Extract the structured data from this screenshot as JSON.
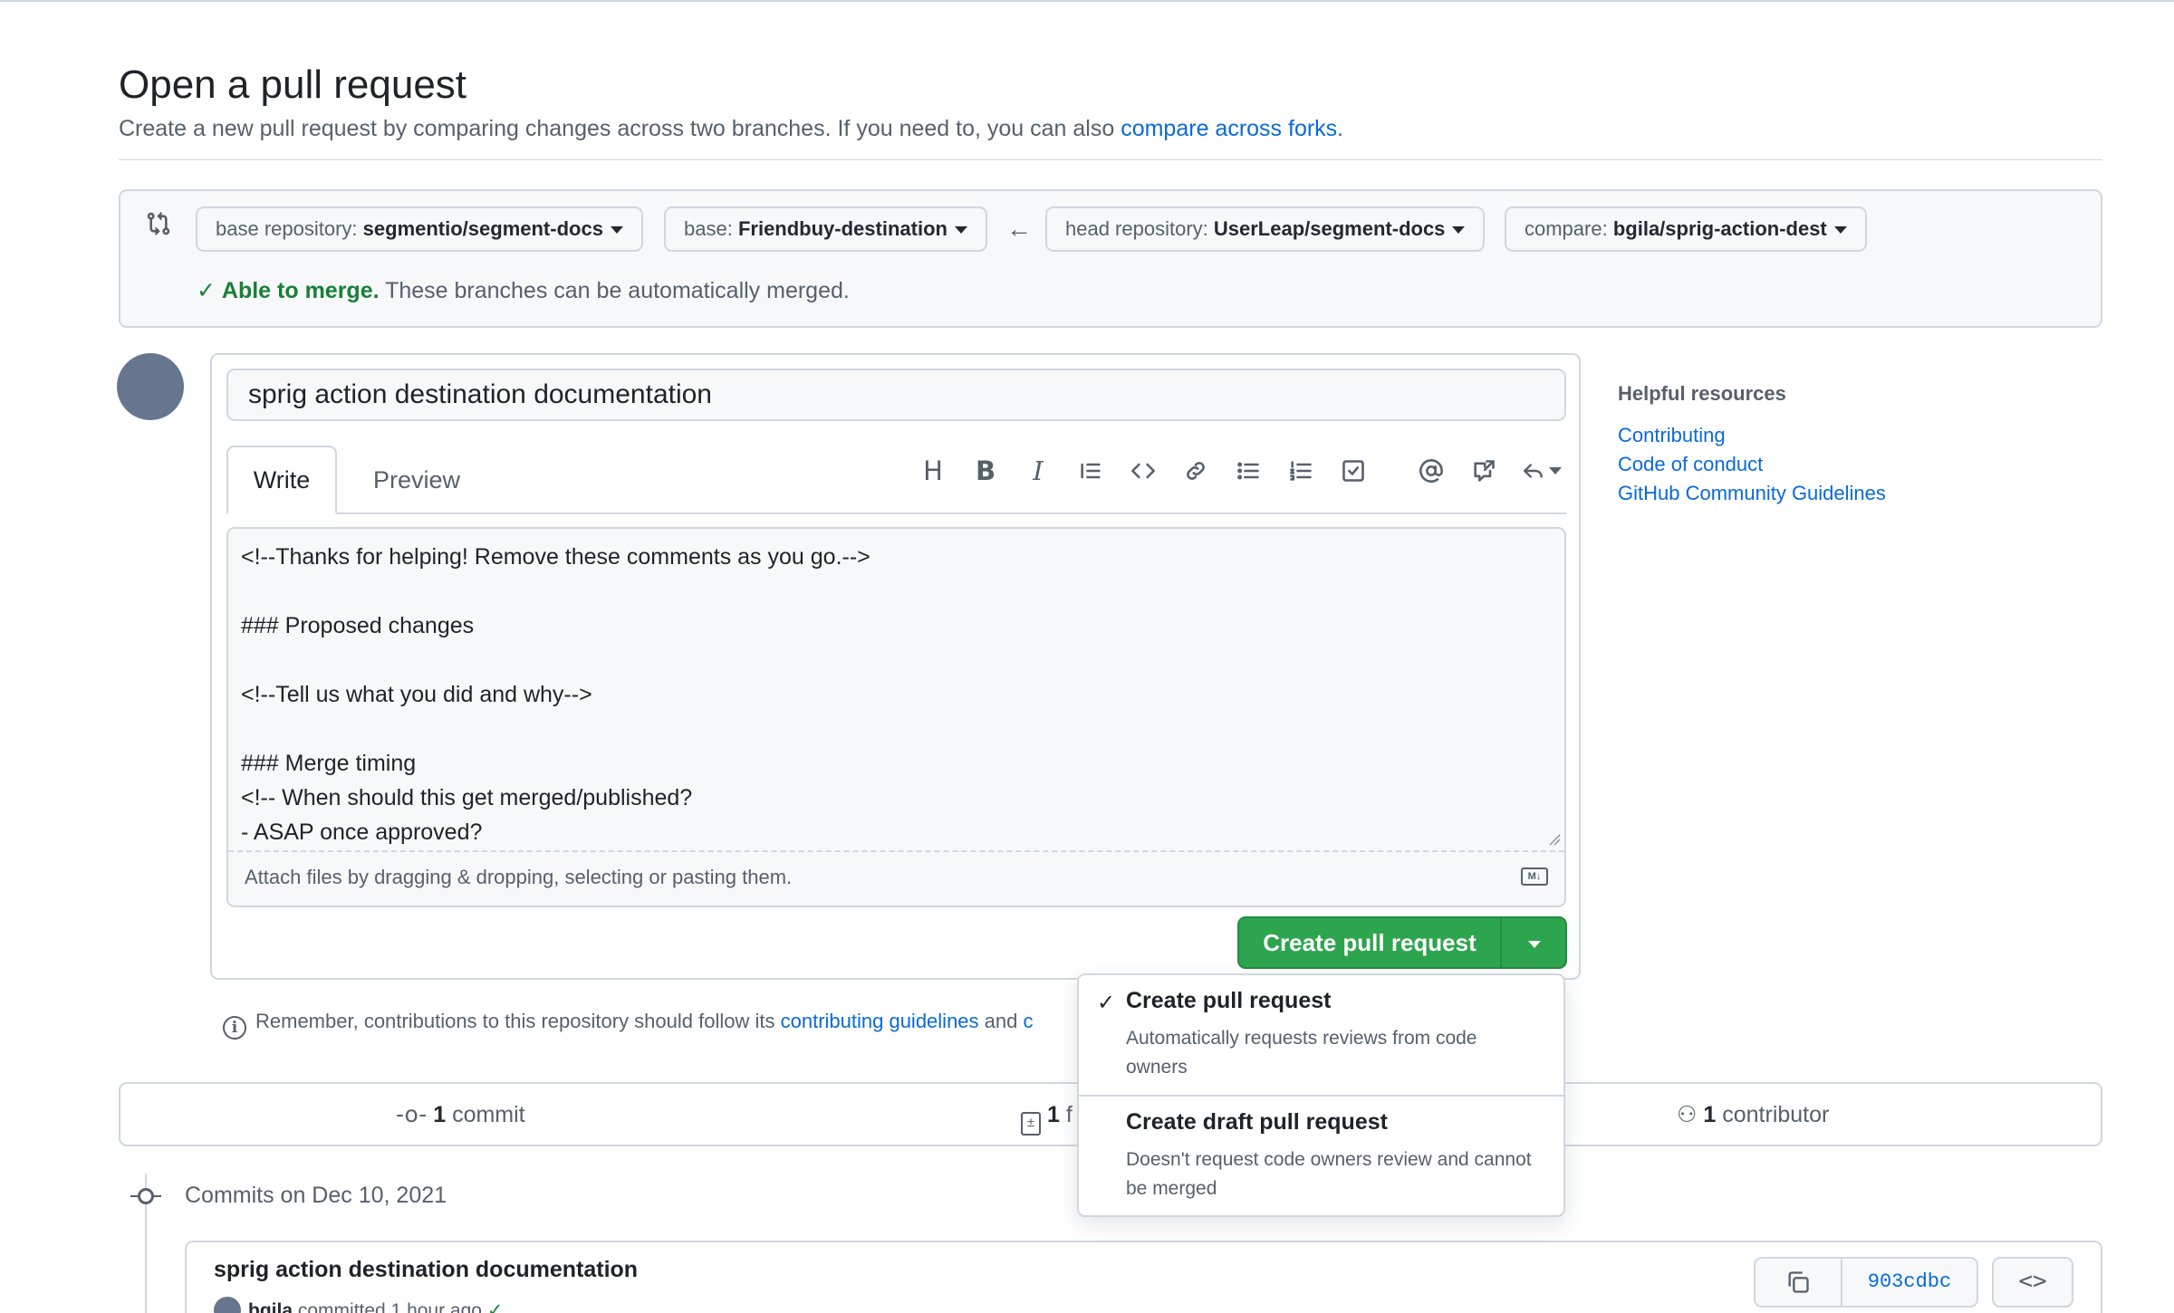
{
  "header": {
    "title": "Open a pull request",
    "subtitle_prefix": "Create a new pull request by comparing changes across two branches. If you need to, you can also ",
    "subtitle_link": "compare across forks",
    "subtitle_suffix": "."
  },
  "range": {
    "base_repo_label": "base repository:",
    "base_repo_value": "segmentio/segment-docs",
    "base_label": "base:",
    "base_value": "Friendbuy-destination",
    "head_repo_label": "head repository:",
    "head_repo_value": "UserLeap/segment-docs",
    "compare_label": "compare:",
    "compare_value": "bgila/sprig-action-dest",
    "merge_ok": "Able to merge.",
    "merge_text": "These branches can be automatically merged."
  },
  "form": {
    "title_value": "sprig action destination documentation",
    "tab_write": "Write",
    "tab_preview": "Preview",
    "toolbar": [
      "heading-icon",
      "bold-icon",
      "italic-icon",
      "quote-icon",
      "code-icon",
      "link-icon",
      "unordered-list-icon",
      "ordered-list-icon",
      "task-list-icon",
      "mention-icon",
      "cross-reference-icon",
      "reply-icon"
    ],
    "body_text": "<!--Thanks for helping! Remove these comments as you go.-->\n\n### Proposed changes\n\n<!--Tell us what you did and why-->\n\n### Merge timing\n<!-- When should this get merged/published?\n- ASAP once approved?",
    "attach_text": "Attach files by dragging & dropping, selecting or pasting them.",
    "markdown_badge": "M↓",
    "submit_label": "Create pull request"
  },
  "sidebar": {
    "heading": "Helpful resources",
    "links": [
      "Contributing",
      "Code of conduct",
      "GitHub Community Guidelines"
    ]
  },
  "remember": {
    "prefix": "Remember, contributions to this repository should follow its ",
    "link1": "contributing guidelines",
    "middle": " and ",
    "link2": "c"
  },
  "summary": {
    "commits_count": "1",
    "commits_label": "commit",
    "files_count": "1",
    "files_label": "f",
    "contributors_count": "1",
    "contributors_label": "contributor"
  },
  "commits": {
    "date_heading": "Commits on Dec 10, 2021",
    "items": [
      {
        "title": "sprig action destination documentation",
        "author": "bgila",
        "meta": "committed 1 hour ago",
        "sha": "903cdbc"
      }
    ]
  },
  "dropdown": {
    "items": [
      {
        "title": "Create pull request",
        "desc": "Automatically requests reviews from code owners",
        "checked": true
      },
      {
        "title": "Create draft pull request",
        "desc": "Doesn't request code owners review and cannot be merged",
        "checked": false
      }
    ]
  },
  "colors": {
    "primary_green": "#2da44e",
    "link_blue": "#0969da",
    "success_green": "#1a7f37",
    "border": "#d0d7de"
  }
}
